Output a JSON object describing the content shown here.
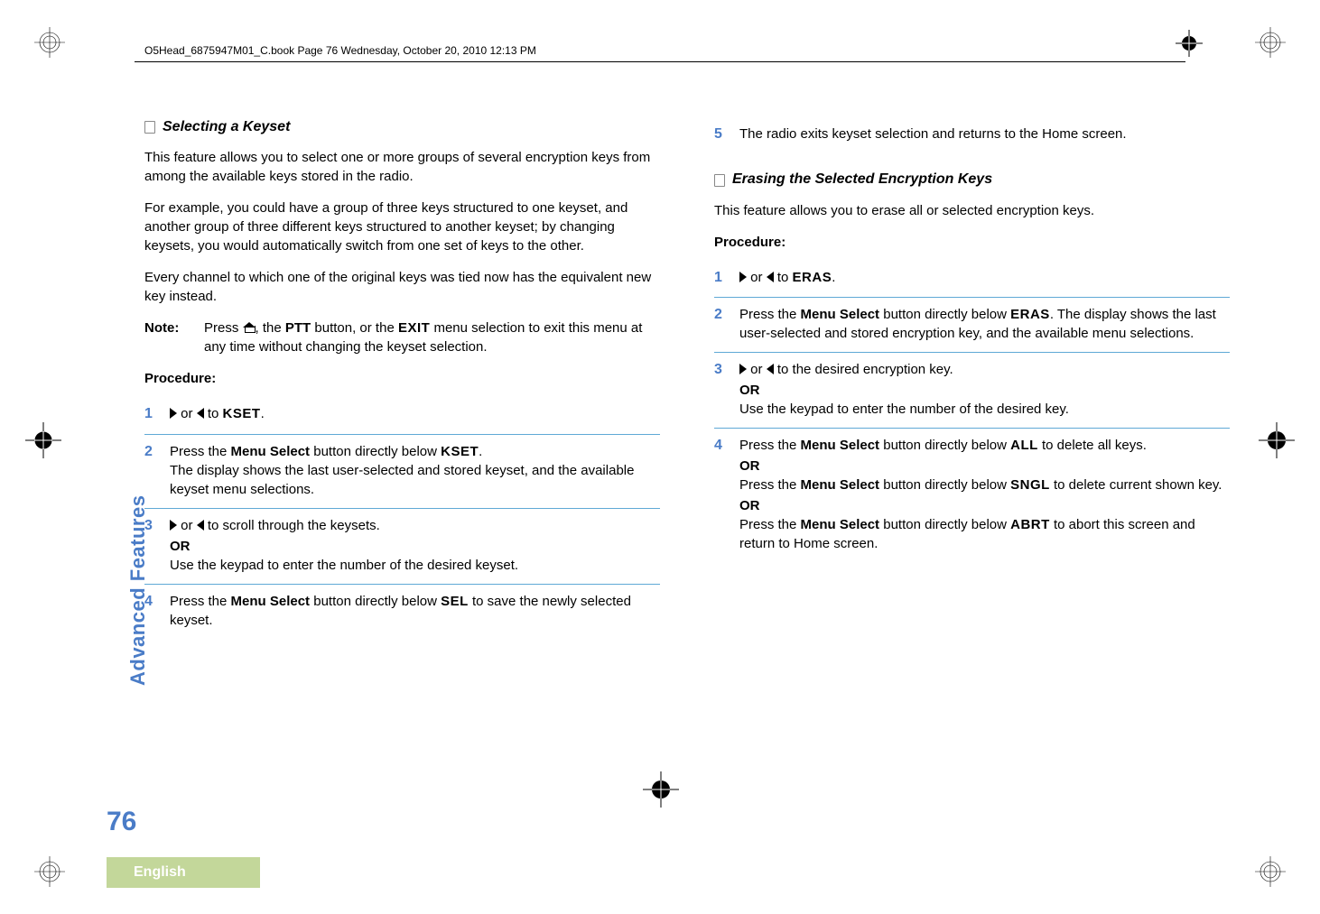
{
  "header": {
    "running": "O5Head_6875947M01_C.book  Page 76  Wednesday, October 20, 2010  12:13 PM"
  },
  "sidebar": {
    "label": "Advanced Features",
    "page_number": "76",
    "language": "English"
  },
  "left": {
    "heading": "Selecting a Keyset",
    "p1": "This feature allows you to select one or more groups of several encryption keys from among the available keys stored in the radio.",
    "p2": "For example, you could have a group of three keys structured to one keyset, and another group of three different keys structured to another keyset; by changing keysets, you would automatically switch from one set of keys to the other.",
    "p3": "Every channel to which one of the original keys was tied now has the equivalent new key instead.",
    "note_label": "Note:",
    "note_a": "Press ",
    "note_b": ", the ",
    "note_ptt": "PTT",
    "note_c": " button, or the ",
    "note_exit": "EXIT",
    "note_d": " menu selection to exit this menu at any time without changing the keyset selection.",
    "procedure": "Procedure:",
    "s1_a": " or ",
    "s1_b": " to ",
    "s1_kset": "KSET",
    "s1_c": ".",
    "s2_a": "Press the ",
    "s2_ms": "Menu Select",
    "s2_b": " button directly below ",
    "s2_kset": "KSET",
    "s2_c": ".",
    "s2_d": "The display shows the last user-selected and stored keyset, and the available keyset menu selections.",
    "s3_a": " or ",
    "s3_b": " to scroll through the keysets.",
    "s3_or": "OR",
    "s3_c": "Use the keypad to enter the number of the desired keyset.",
    "s4_a": "Press the ",
    "s4_ms": "Menu Select",
    "s4_b": " button directly below ",
    "s4_sel": "SEL",
    "s4_c": " to save the newly selected keyset."
  },
  "right": {
    "s5": "The radio exits keyset selection and returns to the Home screen.",
    "heading": "Erasing the Selected Encryption Keys",
    "p1": "This feature allows you to erase all or selected encryption keys.",
    "procedure": "Procedure:",
    "s1_a": " or ",
    "s1_b": " to ",
    "s1_eras": "ERAS",
    "s1_c": ".",
    "s2_a": "Press the ",
    "s2_ms": "Menu Select",
    "s2_b": " button directly below ",
    "s2_eras": "ERAS",
    "s2_c": ". The display shows the last user-selected and stored encryption key, and the available menu selections.",
    "s3_a": " or ",
    "s3_b": " to the desired encryption key.",
    "s3_or": "OR",
    "s3_c": "Use the keypad to enter the number of the desired key.",
    "s4_a": "Press the ",
    "s4_ms": "Menu Select",
    "s4_b": " button directly below ",
    "s4_all": "ALL",
    "s4_c": " to delete all keys.",
    "s4_or1": "OR",
    "s4_d": "Press the ",
    "s4_ms2": "Menu Select",
    "s4_e": " button directly below ",
    "s4_sngl": "SNGL",
    "s4_f": " to delete current shown key.",
    "s4_or2": "OR",
    "s4_g": "Press the ",
    "s4_ms3": "Menu Select",
    "s4_h": " button directly below ",
    "s4_abrt": "ABRT",
    "s4_i": " to abort this screen and return to Home screen."
  }
}
